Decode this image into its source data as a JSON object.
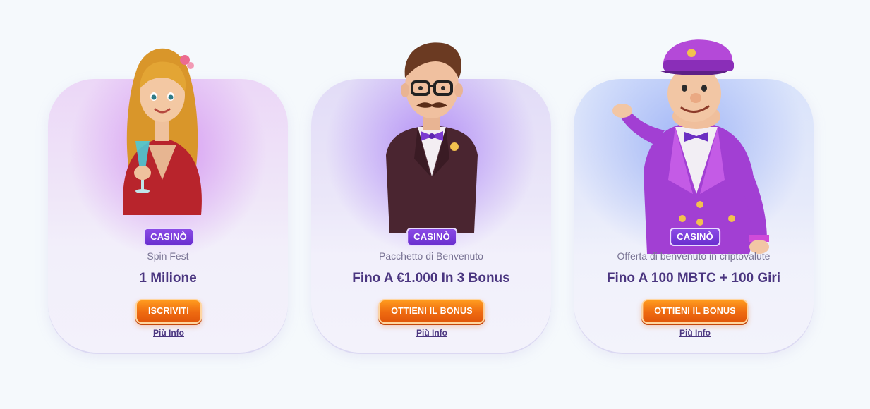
{
  "offers": [
    {
      "badge": "CASINÒ",
      "subtitle": "Spin Fest",
      "headline": "1 Milione",
      "cta": "ISCRIVITI",
      "info": "Più Info",
      "character_icon": "woman-with-cocktail-mascot"
    },
    {
      "badge": "CASINÒ",
      "subtitle": "Pacchetto di Benvenuto",
      "headline": "Fino A €1.000 In 3 Bonus",
      "cta": "OTTIENI IL BONUS",
      "info": "Più Info",
      "character_icon": "gentleman-with-glasses-mascot"
    },
    {
      "badge": "CASINÒ",
      "subtitle": "Offerta di benvenuto in criptovalute",
      "headline": "Fino A 100 MBTC + 100 Giri",
      "cta": "OTTIENI IL BONUS",
      "info": "Più Info",
      "character_icon": "bellhop-mascot"
    }
  ],
  "colors": {
    "page_bg": "#f5f9fc",
    "badge": "#7a3fe0",
    "headline": "#4b3680",
    "subtitle": "#7a7495",
    "cta": "#ef6c10"
  }
}
